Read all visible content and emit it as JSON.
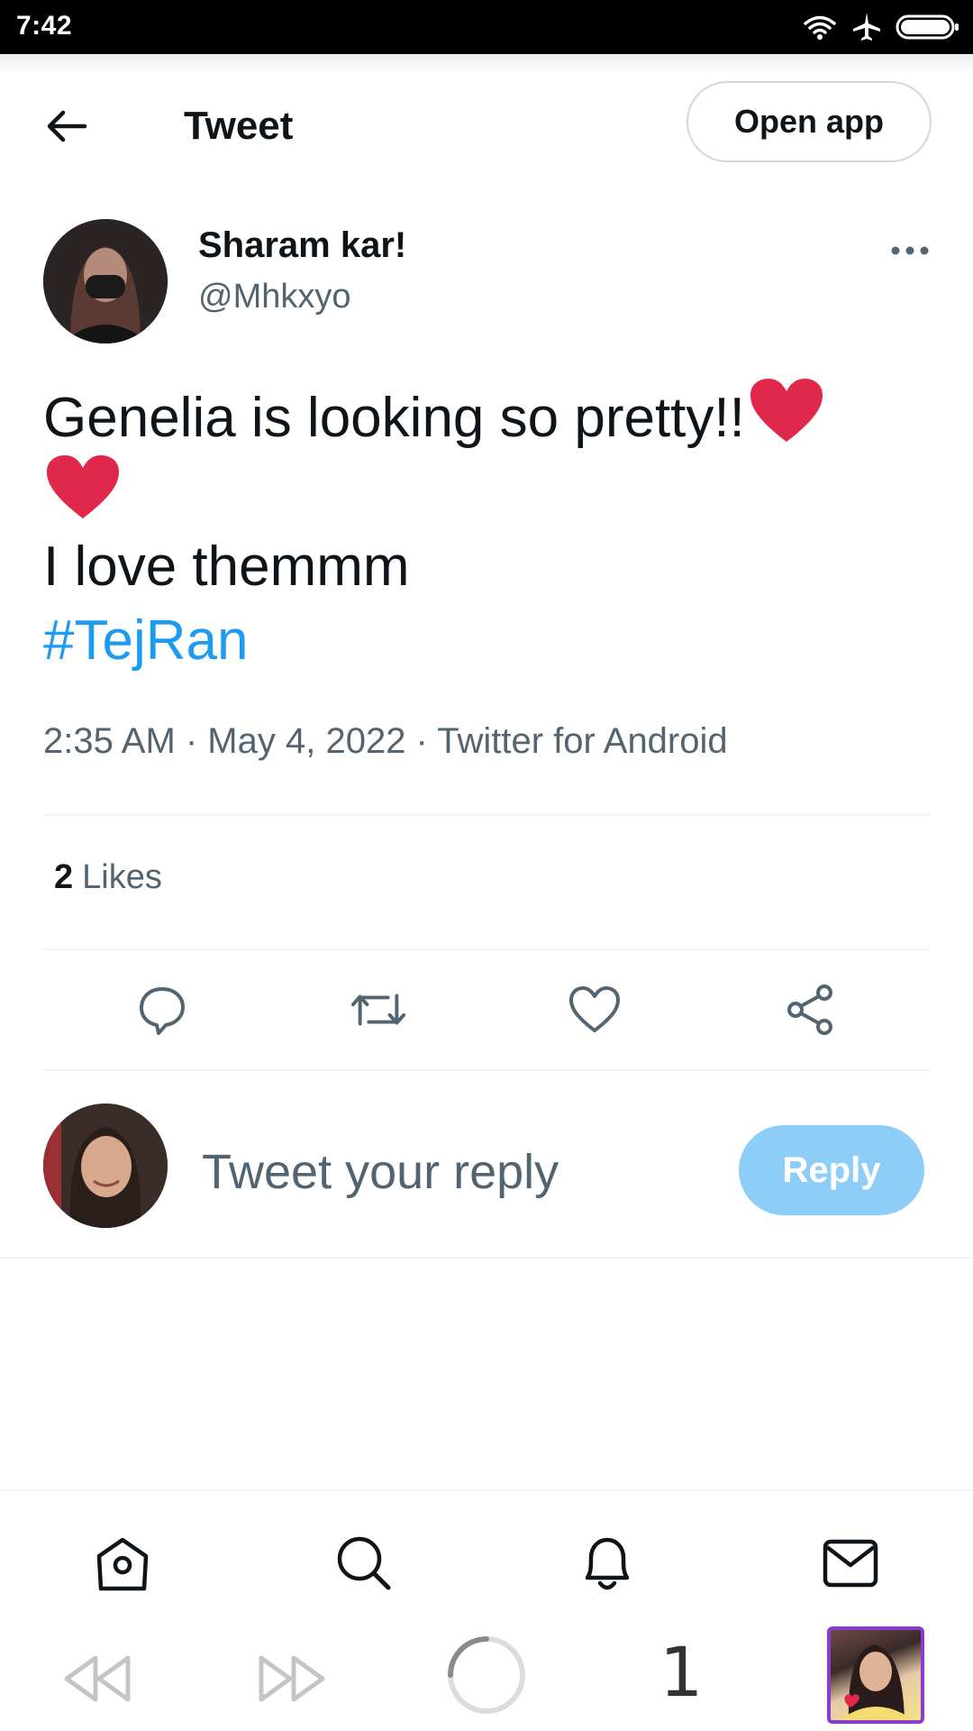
{
  "status_bar": {
    "time": "7:42",
    "icons": [
      "wifi-icon",
      "airplane-icon",
      "battery-icon"
    ]
  },
  "header": {
    "title": "Tweet",
    "open_app_label": "Open app"
  },
  "tweet": {
    "author_name": "Sharam kar!",
    "author_handle": "@Mhkxyo",
    "text_line1": "Genelia is looking so pretty!!",
    "text_line3": "I love themmm",
    "hashtag": "#TejRan",
    "meta": "2:35 AM · May 4, 2022 · Twitter for Android",
    "likes_count": "2",
    "likes_label": "Likes"
  },
  "reply": {
    "placeholder": "Tweet your reply",
    "button_label": "Reply"
  },
  "browser": {
    "tab_count": "1"
  },
  "colors": {
    "accent": "#1d9bf0",
    "reply_button": "#8ecdf8",
    "heart": "#e0284a",
    "secondary_text": "#536471"
  }
}
